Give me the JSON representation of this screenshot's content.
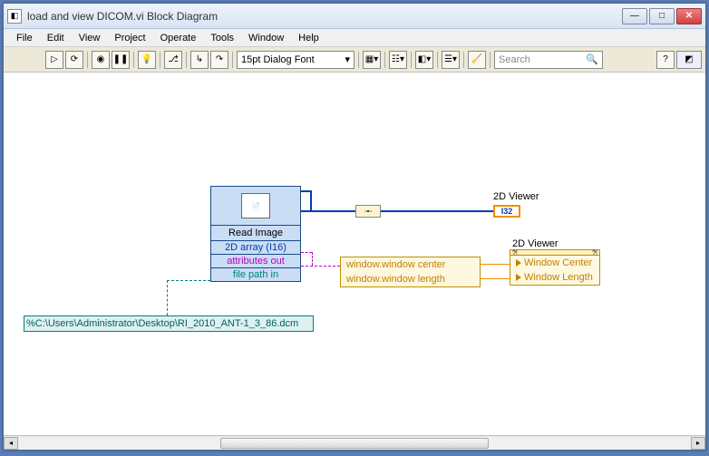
{
  "window": {
    "title": "load and view DICOM.vi Block Diagram"
  },
  "menu": {
    "file": "File",
    "edit": "Edit",
    "view": "View",
    "project": "Project",
    "operate": "Operate",
    "tools": "Tools",
    "window": "Window",
    "help": "Help"
  },
  "toolbar": {
    "font": "15pt Dialog Font",
    "search_placeholder": "Search"
  },
  "diagram": {
    "read_image": {
      "title": "Read Image",
      "out1": "2D array (I16)",
      "out2": "attributes out",
      "in1": "file path in"
    },
    "viewer1_label": "2D Viewer",
    "i32": "I32",
    "viewer2_label": "2D Viewer",
    "unbundle": {
      "r1": "window.window center",
      "r2": "window.window length"
    },
    "cluster": {
      "r1": "Window Center",
      "r2": "Window Length"
    },
    "filepath": "%C:\\Users\\Administrator\\Desktop\\RI_2010_ANT-1_3_86.dcm"
  }
}
